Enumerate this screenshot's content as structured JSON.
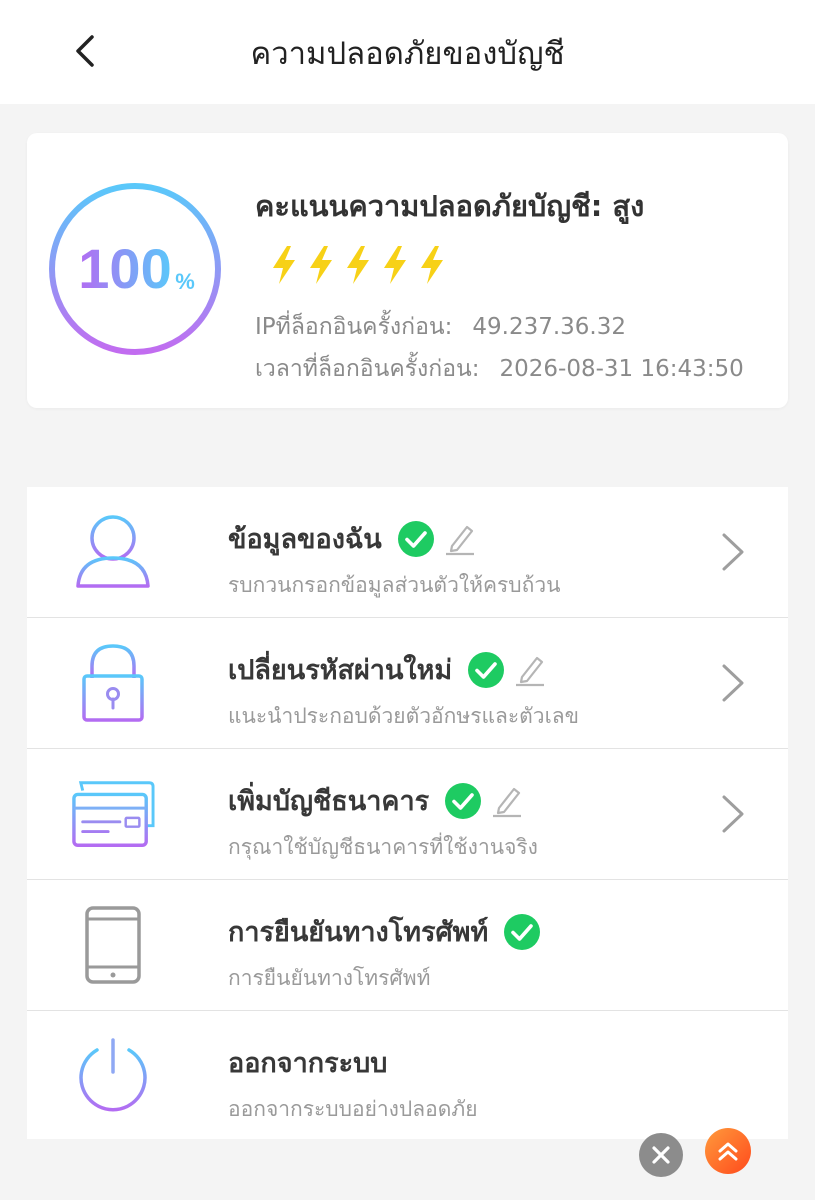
{
  "header": {
    "title": "ความปลอดภัยของบัญชี",
    "back_icon": "chevron-left-icon"
  },
  "score_card": {
    "percent_number": "100",
    "percent_sign": "%",
    "score_level": 1.0,
    "label": "คะแนนความปลอดภัยบัญชี: สูง",
    "rating": 5,
    "rating_max": 5,
    "ring_gradient": [
      "#5ac8fa",
      "#b36cf2"
    ],
    "bolt_color": "#f7d117",
    "last_ip_label": "IPที่ล็อกอินครั้งก่อน:",
    "last_ip_value": "49.237.36.32",
    "last_time_label": "เวลาที่ล็อกอินครั้งก่อน:",
    "last_time_value": "2026-08-31 16:43:50"
  },
  "menu": {
    "items": [
      {
        "title": "ข้อมูลของฉัน",
        "subtitle": "รบกวนกรอกข้อมูลส่วนตัวให้ครบถ้วน",
        "icon": "user-icon",
        "verified": true,
        "editable": true,
        "has_arrow": true
      },
      {
        "title": "เปลี่ยนรหัสผ่านใหม่",
        "subtitle": "แนะนำประกอบด้วยตัวอักษรและตัวเลข",
        "icon": "lock-icon",
        "verified": true,
        "editable": true,
        "has_arrow": true
      },
      {
        "title": "เพิ่มบัญชีธนาคาร",
        "subtitle": "กรุณาใช้บัญชีธนาคารที่ใช้งานจริง",
        "icon": "bank-card-icon",
        "verified": true,
        "editable": true,
        "has_arrow": true
      },
      {
        "title": "การยืนยันทางโทรศัพท์",
        "subtitle": "การยืนยันทางโทรศัพท์",
        "icon": "phone-icon",
        "verified": true,
        "editable": false,
        "has_arrow": false
      },
      {
        "title": "ออกจากระบบ",
        "subtitle": "ออกจากระบบอย่างปลอดภัย",
        "icon": "power-icon",
        "verified": false,
        "editable": false,
        "has_arrow": false
      }
    ]
  },
  "colors": {
    "verified_green": "#1ecb62",
    "accent_orange": "#ff6a1c",
    "icon_blue": "#5ac8fa",
    "icon_purple": "#b36cf2"
  },
  "floating": {
    "close_icon": "close-icon",
    "scroll_top_icon": "double-chevron-up-icon"
  }
}
